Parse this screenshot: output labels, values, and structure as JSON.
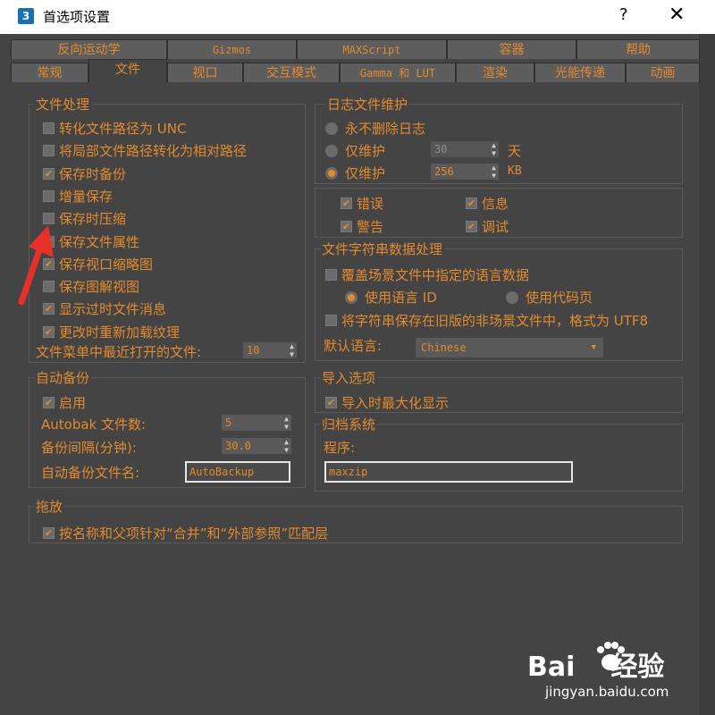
{
  "window": {
    "app_icon": "3",
    "title": "首选项设置",
    "help": "?",
    "close": "✕"
  },
  "tabs_row1": [
    "反向运动学",
    "Gizmos",
    "MAXScript",
    "容器",
    "帮助"
  ],
  "tabs_row2": [
    "常规",
    "文件",
    "视口",
    "交互模式",
    "Gamma 和 LUT",
    "渲染",
    "光能传递",
    "动画"
  ],
  "file_handling": {
    "label": "文件处理",
    "items": [
      {
        "label": "转化文件路径为 UNC",
        "checked": false
      },
      {
        "label": "将局部文件路径转化为相对路径",
        "checked": false
      },
      {
        "label": "保存时备份",
        "checked": true
      },
      {
        "label": "增量保存",
        "checked": false
      },
      {
        "label": "保存时压缩",
        "checked": false
      },
      {
        "label": "保存文件属性",
        "checked": true
      },
      {
        "label": "保存视口缩略图",
        "checked": true
      },
      {
        "label": "保存图解视图",
        "checked": false
      },
      {
        "label": "显示过时文件消息",
        "checked": true
      },
      {
        "label": "更改时重新加载纹理",
        "checked": true
      }
    ],
    "recent_label": "文件菜单中最近打开的文件:",
    "recent_value": "10"
  },
  "log": {
    "label": "日志文件维护",
    "never_delete": "永不删除日志",
    "keep1": "仅维护",
    "keep1_value": "30",
    "keep1_unit": "天",
    "keep2": "仅维护",
    "keep2_value": "256",
    "keep2_unit": "KB",
    "selected": 2
  },
  "log_types": [
    {
      "label": "错误",
      "checked": true
    },
    {
      "label": "信息",
      "checked": true
    },
    {
      "label": "警告",
      "checked": true
    },
    {
      "label": "调试",
      "checked": true
    }
  ],
  "string_data": {
    "label": "文件字符串数据处理",
    "override": "覆盖场景文件中指定的语言数据",
    "use_lang_id": "使用语言 ID",
    "use_codepage": "使用代码页",
    "save_utf8": "将字符串保存在旧版的非场景文件中，格式为 UTF8",
    "default_lang_label": "默认语言:",
    "default_lang": "Chinese"
  },
  "autobackup": {
    "label": "自动备份",
    "enable": "启用",
    "count_label": "Autobak 文件数:",
    "count_value": "5",
    "interval_label": "备份间隔(分钟):",
    "interval_value": "30.0",
    "name_label": "自动备份文件名:",
    "name_value": "AutoBackup"
  },
  "import": {
    "label": "导入选项",
    "maximize": "导入时最大化显示"
  },
  "archive": {
    "label": "归档系统",
    "program_label": "程序:",
    "program_value": "maxzip"
  },
  "dragdrop": {
    "label": "拖放",
    "match": "按名称和父项针对“合并”和“外部参照”匹配层"
  },
  "watermark": {
    "brand": "Bai",
    "brand2": "经验",
    "url": "jingyan.baidu.com"
  },
  "colors": {
    "accent": "#e38a2f",
    "panel": "#444444",
    "arrow": "#e8302a"
  }
}
